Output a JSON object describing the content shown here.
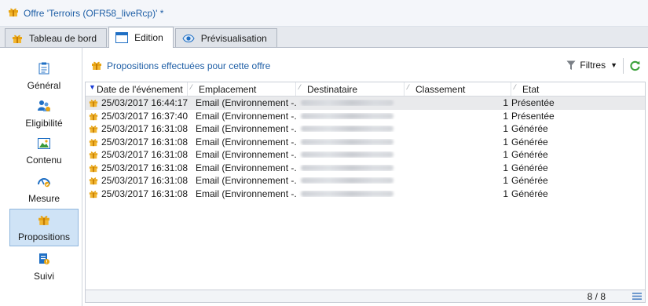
{
  "window": {
    "title": "Offre 'Terroirs (OFR58_liveRcp)' *"
  },
  "tabs": [
    {
      "label": "Tableau de bord",
      "icon": "gift-icon",
      "active": false
    },
    {
      "label": "Edition",
      "icon": "window-icon",
      "active": true
    },
    {
      "label": "Prévisualisation",
      "icon": "eye-icon",
      "active": false
    }
  ],
  "sidebar": {
    "items": [
      {
        "label": "Général",
        "icon": "clipboard-icon"
      },
      {
        "label": "Eligibilité",
        "icon": "users-icon"
      },
      {
        "label": "Contenu",
        "icon": "image-icon"
      },
      {
        "label": "Mesure",
        "icon": "gauge-icon"
      },
      {
        "label": "Propositions",
        "icon": "gift-icon",
        "active": true
      },
      {
        "label": "Suivi",
        "icon": "report-icon"
      }
    ]
  },
  "main": {
    "heading": "Propositions effectuées pour cette offre",
    "filters_label": "Filtres",
    "columns": [
      "Date de l'événement",
      "Emplacement",
      "Destinataire",
      "Classement",
      "Etat"
    ],
    "rows": [
      {
        "date": "25/03/2017 16:44:17",
        "location": "Email (Environnement -...",
        "rank": "1",
        "state": "Présentée"
      },
      {
        "date": "25/03/2017 16:37:40",
        "location": "Email (Environnement -...",
        "rank": "1",
        "state": "Présentée"
      },
      {
        "date": "25/03/2017 16:31:08",
        "location": "Email (Environnement -...",
        "rank": "1",
        "state": "Générée"
      },
      {
        "date": "25/03/2017 16:31:08",
        "location": "Email (Environnement -...",
        "rank": "1",
        "state": "Générée"
      },
      {
        "date": "25/03/2017 16:31:08",
        "location": "Email (Environnement -...",
        "rank": "1",
        "state": "Générée"
      },
      {
        "date": "25/03/2017 16:31:08",
        "location": "Email (Environnement -...",
        "rank": "1",
        "state": "Générée"
      },
      {
        "date": "25/03/2017 16:31:08",
        "location": "Email (Environnement -...",
        "rank": "1",
        "state": "Générée"
      },
      {
        "date": "25/03/2017 16:31:08",
        "location": "Email (Environnement -...",
        "rank": "1",
        "state": "Générée"
      }
    ],
    "footer_count": "8 / 8"
  },
  "colors": {
    "accent": "#1f5fa6",
    "gift": "#e8a413",
    "active_nav": "#cfe3f6",
    "refresh": "#3aa13a"
  }
}
